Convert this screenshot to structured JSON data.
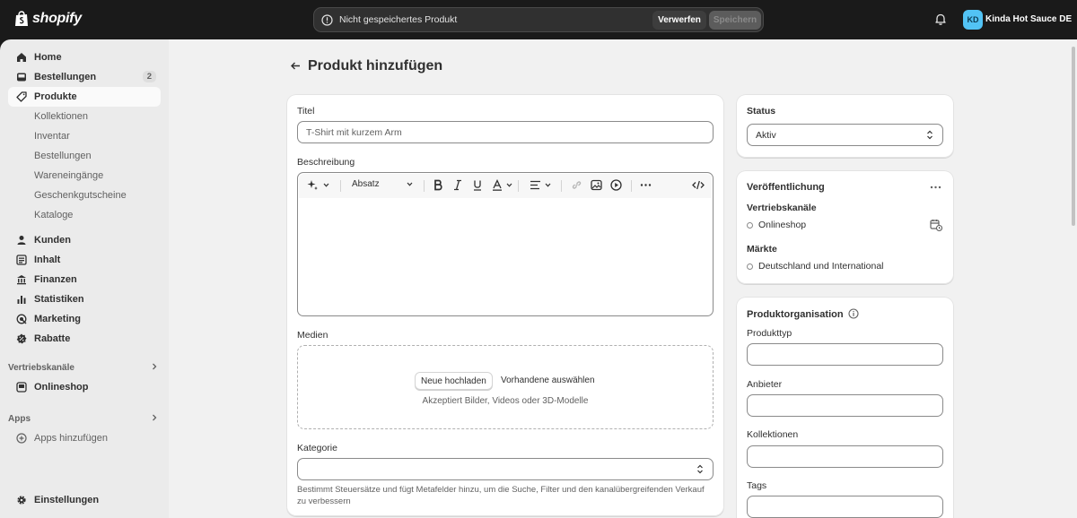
{
  "topbar": {
    "brand": "shopify",
    "unsaved_message": "Nicht gespeichertes Produkt",
    "discard_label": "Verwerfen",
    "save_label": "Speichern",
    "avatar_initials": "KD",
    "store_name": "Kinda Hot Sauce DE"
  },
  "sidebar": {
    "items": [
      {
        "label": "Home",
        "icon": "home-icon"
      },
      {
        "label": "Bestellungen",
        "icon": "inbox-icon",
        "badge": "2"
      },
      {
        "label": "Produkte",
        "icon": "tag-icon"
      },
      {
        "label": "Kunden",
        "icon": "person-icon"
      },
      {
        "label": "Inhalt",
        "icon": "content-icon"
      },
      {
        "label": "Finanzen",
        "icon": "bank-icon"
      },
      {
        "label": "Statistiken",
        "icon": "bar-chart-icon"
      },
      {
        "label": "Marketing",
        "icon": "target-icon"
      },
      {
        "label": "Rabatte",
        "icon": "discount-icon"
      }
    ],
    "product_subitems": [
      "Kollektionen",
      "Inventar",
      "Bestellungen",
      "Wareneingänge",
      "Geschenkgutscheine",
      "Kataloge"
    ],
    "sales_channels_label": "Vertriebskanäle",
    "online_store_label": "Onlineshop",
    "apps_label": "Apps",
    "add_apps_label": "Apps hinzufügen",
    "settings_label": "Einstellungen"
  },
  "page": {
    "title": "Produkt hinzufügen"
  },
  "main_card": {
    "title_label": "Titel",
    "title_placeholder": "T-Shirt mit kurzem Arm",
    "description_label": "Beschreibung",
    "toolbar_paragraph": "Absatz",
    "media_label": "Medien",
    "upload_button": "Neue hochladen",
    "select_existing": "Vorhandene auswählen",
    "media_hint": "Akzeptiert Bilder, Videos oder 3D-Modelle",
    "category_label": "Kategorie",
    "category_help": "Bestimmt Steuersätze und fügt Metafelder hinzu, um die Suche, Filter und den kanalübergreifenden Verkauf zu verbessern"
  },
  "status_card": {
    "label": "Status",
    "value": "Aktiv"
  },
  "publishing_card": {
    "title": "Veröffentlichung",
    "channels_label": "Vertriebskanäle",
    "channel": "Onlineshop",
    "markets_label": "Märkte",
    "market": "Deutschland und International"
  },
  "organization_card": {
    "title": "Produktorganisation",
    "type_label": "Produkttyp",
    "vendor_label": "Anbieter",
    "collections_label": "Kollektionen",
    "tags_label": "Tags"
  },
  "colors": {
    "topbar": "#1a1a1a",
    "sidebar": "#ebebeb",
    "canvas": "#f1f1f1",
    "avatar": "#52c3f5"
  }
}
